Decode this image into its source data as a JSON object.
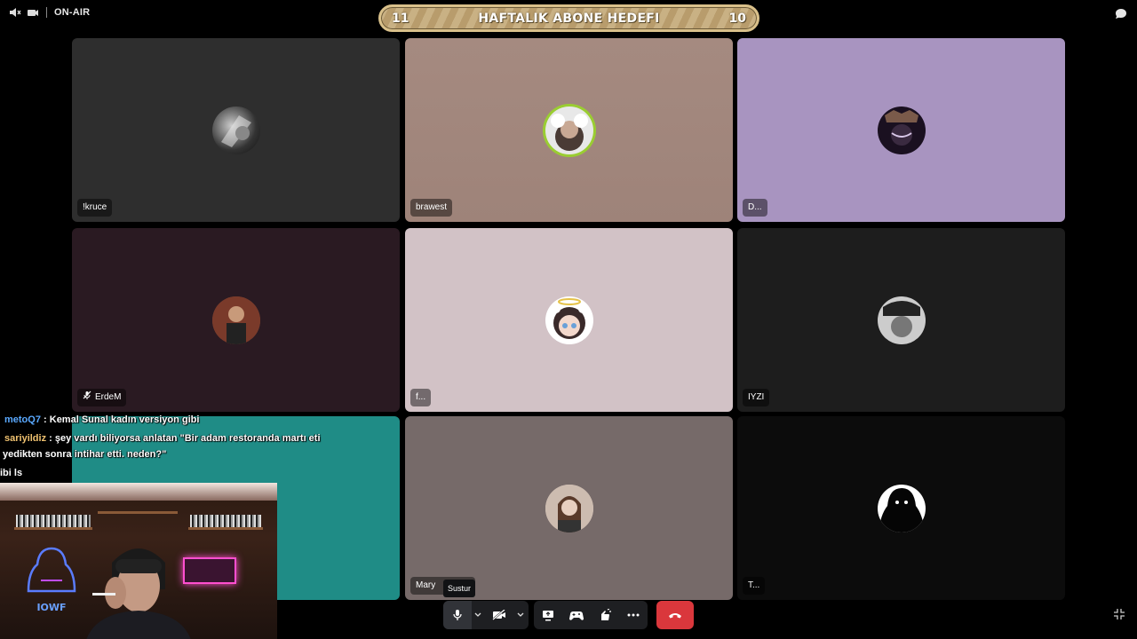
{
  "topbar": {
    "status_label": "ON-AIR",
    "icons": [
      "volume-mute-icon",
      "camera-icon",
      "chat-bubble-icon"
    ]
  },
  "subscriber_goal": {
    "left_value": "11",
    "title": "HAFTALIK ABONE HEDEFI",
    "right_value": "10"
  },
  "participants": [
    {
      "name": "!kruce",
      "bg": "#2e2e2e"
    },
    {
      "name": "brawest",
      "bg": "#a88b82"
    },
    {
      "name": "D...",
      "bg": "#a894c0"
    },
    {
      "name": "ErdeM",
      "bg": "#2a1a22",
      "icon": "mic-off-icon"
    },
    {
      "name": "f...",
      "bg": "#d2c2c6"
    },
    {
      "name": "IYZI",
      "bg": "#1d1d1d"
    },
    {
      "name": "",
      "bg": "#1f8c86"
    },
    {
      "name": "Mary",
      "name_tail": "y",
      "bg": "#766a69"
    },
    {
      "name": "T...",
      "bg": "#0c0c0c"
    }
  ],
  "chat": [
    {
      "user": "metoQ7",
      "text": " : Kemal Sunal kadın versiyon gibi"
    },
    {
      "user": "sariyildiz",
      "text": " : şey vardı biliyorsa anlatan \"Bir adam restoranda martı eti"
    },
    {
      "user": "",
      "text": "yedikten sonra intihar etti. neden?\""
    },
    {
      "user": "",
      "text": "ibi ls"
    }
  ],
  "controls": {
    "tooltip": "Sustur",
    "buttons": [
      "microphone-icon",
      "chevron-down-icon",
      "camera-off-icon",
      "chevron-down-icon",
      "screen-share-icon",
      "activity-gamepad-icon",
      "soundboard-icon",
      "more-icon",
      "hang-up-icon",
      "minimize-icon"
    ]
  },
  "colors": {
    "hangup": "#da373c",
    "goal_border": "#d9c08a",
    "chat_user1": "#5aa9ff",
    "chat_user2": "#f0c270",
    "speaking_ring": "#9acd32"
  },
  "webcam": {
    "logo_text": "IOWF"
  }
}
